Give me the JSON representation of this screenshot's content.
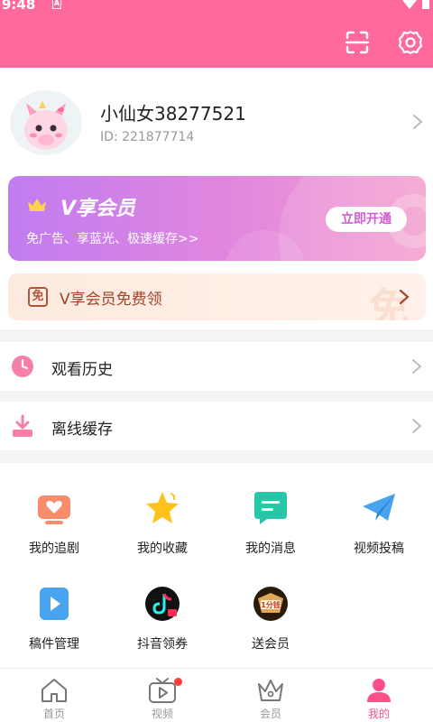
{
  "status_bar": {
    "time": "9:48",
    "notification_glyph": "A"
  },
  "header": {
    "scan_icon": "scan-icon",
    "settings_icon": "gear-icon"
  },
  "profile": {
    "username": "小仙女38277521",
    "user_id": "ID: 221877714"
  },
  "vip_card": {
    "title": "V享会员",
    "subtitle": "免广告、享蓝光、极速缓存>>",
    "button": "立即开通"
  },
  "free_banner": {
    "badge": "免",
    "text": "V享会员免费领",
    "watermark": "免"
  },
  "menu": [
    {
      "label": "观看历史",
      "icon": "clock-icon"
    },
    {
      "label": "离线缓存",
      "icon": "download-icon"
    }
  ],
  "grid": [
    {
      "label": "我的追剧",
      "icon": "tv-heart-icon"
    },
    {
      "label": "我的收藏",
      "icon": "star-icon"
    },
    {
      "label": "我的消息",
      "icon": "message-icon"
    },
    {
      "label": "视频投稿",
      "icon": "paper-plane-icon"
    },
    {
      "label": "稿件管理",
      "icon": "play-file-icon"
    },
    {
      "label": "抖音领券",
      "icon": "douyin-icon"
    },
    {
      "label": "送会员",
      "icon": "gift-vip-icon",
      "badge_text": "1分钱"
    }
  ],
  "tabbar": [
    {
      "label": "首页",
      "icon": "home-icon",
      "active": false
    },
    {
      "label": "视频",
      "icon": "video-icon",
      "active": false,
      "has_dot": true
    },
    {
      "label": "会员",
      "icon": "crown-icon",
      "active": false
    },
    {
      "label": "我的",
      "icon": "profile-icon",
      "active": true
    }
  ],
  "colors": {
    "header": "#ff6a9a",
    "accent": "#ff4f8b",
    "vip_gradient_start": "#c07cf0",
    "vip_gradient_end": "#f4a2cf"
  }
}
